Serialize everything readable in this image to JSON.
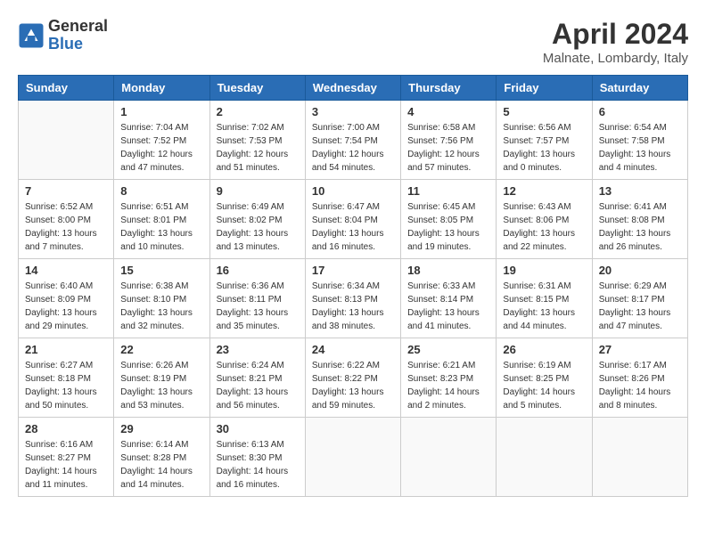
{
  "logo": {
    "general": "General",
    "blue": "Blue"
  },
  "title": "April 2024",
  "location": "Malnate, Lombardy, Italy",
  "days_of_week": [
    "Sunday",
    "Monday",
    "Tuesday",
    "Wednesday",
    "Thursday",
    "Friday",
    "Saturday"
  ],
  "weeks": [
    [
      {
        "day": "",
        "info": ""
      },
      {
        "day": "1",
        "info": "Sunrise: 7:04 AM\nSunset: 7:52 PM\nDaylight: 12 hours\nand 47 minutes."
      },
      {
        "day": "2",
        "info": "Sunrise: 7:02 AM\nSunset: 7:53 PM\nDaylight: 12 hours\nand 51 minutes."
      },
      {
        "day": "3",
        "info": "Sunrise: 7:00 AM\nSunset: 7:54 PM\nDaylight: 12 hours\nand 54 minutes."
      },
      {
        "day": "4",
        "info": "Sunrise: 6:58 AM\nSunset: 7:56 PM\nDaylight: 12 hours\nand 57 minutes."
      },
      {
        "day": "5",
        "info": "Sunrise: 6:56 AM\nSunset: 7:57 PM\nDaylight: 13 hours\nand 0 minutes."
      },
      {
        "day": "6",
        "info": "Sunrise: 6:54 AM\nSunset: 7:58 PM\nDaylight: 13 hours\nand 4 minutes."
      }
    ],
    [
      {
        "day": "7",
        "info": "Sunrise: 6:52 AM\nSunset: 8:00 PM\nDaylight: 13 hours\nand 7 minutes."
      },
      {
        "day": "8",
        "info": "Sunrise: 6:51 AM\nSunset: 8:01 PM\nDaylight: 13 hours\nand 10 minutes."
      },
      {
        "day": "9",
        "info": "Sunrise: 6:49 AM\nSunset: 8:02 PM\nDaylight: 13 hours\nand 13 minutes."
      },
      {
        "day": "10",
        "info": "Sunrise: 6:47 AM\nSunset: 8:04 PM\nDaylight: 13 hours\nand 16 minutes."
      },
      {
        "day": "11",
        "info": "Sunrise: 6:45 AM\nSunset: 8:05 PM\nDaylight: 13 hours\nand 19 minutes."
      },
      {
        "day": "12",
        "info": "Sunrise: 6:43 AM\nSunset: 8:06 PM\nDaylight: 13 hours\nand 22 minutes."
      },
      {
        "day": "13",
        "info": "Sunrise: 6:41 AM\nSunset: 8:08 PM\nDaylight: 13 hours\nand 26 minutes."
      }
    ],
    [
      {
        "day": "14",
        "info": "Sunrise: 6:40 AM\nSunset: 8:09 PM\nDaylight: 13 hours\nand 29 minutes."
      },
      {
        "day": "15",
        "info": "Sunrise: 6:38 AM\nSunset: 8:10 PM\nDaylight: 13 hours\nand 32 minutes."
      },
      {
        "day": "16",
        "info": "Sunrise: 6:36 AM\nSunset: 8:11 PM\nDaylight: 13 hours\nand 35 minutes."
      },
      {
        "day": "17",
        "info": "Sunrise: 6:34 AM\nSunset: 8:13 PM\nDaylight: 13 hours\nand 38 minutes."
      },
      {
        "day": "18",
        "info": "Sunrise: 6:33 AM\nSunset: 8:14 PM\nDaylight: 13 hours\nand 41 minutes."
      },
      {
        "day": "19",
        "info": "Sunrise: 6:31 AM\nSunset: 8:15 PM\nDaylight: 13 hours\nand 44 minutes."
      },
      {
        "day": "20",
        "info": "Sunrise: 6:29 AM\nSunset: 8:17 PM\nDaylight: 13 hours\nand 47 minutes."
      }
    ],
    [
      {
        "day": "21",
        "info": "Sunrise: 6:27 AM\nSunset: 8:18 PM\nDaylight: 13 hours\nand 50 minutes."
      },
      {
        "day": "22",
        "info": "Sunrise: 6:26 AM\nSunset: 8:19 PM\nDaylight: 13 hours\nand 53 minutes."
      },
      {
        "day": "23",
        "info": "Sunrise: 6:24 AM\nSunset: 8:21 PM\nDaylight: 13 hours\nand 56 minutes."
      },
      {
        "day": "24",
        "info": "Sunrise: 6:22 AM\nSunset: 8:22 PM\nDaylight: 13 hours\nand 59 minutes."
      },
      {
        "day": "25",
        "info": "Sunrise: 6:21 AM\nSunset: 8:23 PM\nDaylight: 14 hours\nand 2 minutes."
      },
      {
        "day": "26",
        "info": "Sunrise: 6:19 AM\nSunset: 8:25 PM\nDaylight: 14 hours\nand 5 minutes."
      },
      {
        "day": "27",
        "info": "Sunrise: 6:17 AM\nSunset: 8:26 PM\nDaylight: 14 hours\nand 8 minutes."
      }
    ],
    [
      {
        "day": "28",
        "info": "Sunrise: 6:16 AM\nSunset: 8:27 PM\nDaylight: 14 hours\nand 11 minutes."
      },
      {
        "day": "29",
        "info": "Sunrise: 6:14 AM\nSunset: 8:28 PM\nDaylight: 14 hours\nand 14 minutes."
      },
      {
        "day": "30",
        "info": "Sunrise: 6:13 AM\nSunset: 8:30 PM\nDaylight: 14 hours\nand 16 minutes."
      },
      {
        "day": "",
        "info": ""
      },
      {
        "day": "",
        "info": ""
      },
      {
        "day": "",
        "info": ""
      },
      {
        "day": "",
        "info": ""
      }
    ]
  ]
}
